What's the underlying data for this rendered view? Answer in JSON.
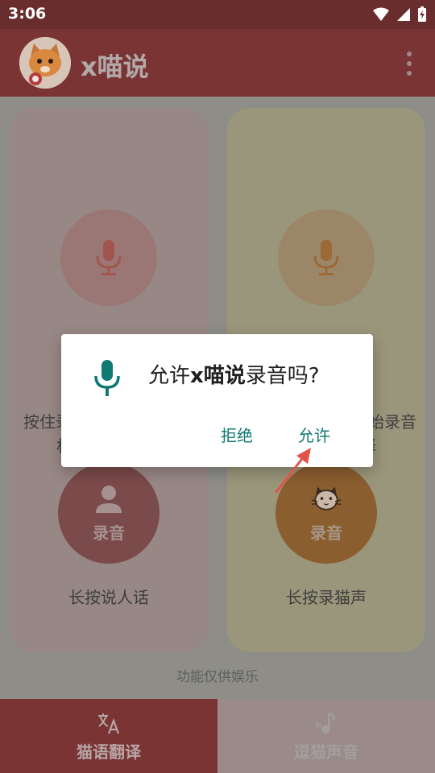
{
  "status_bar": {
    "time": "3:06"
  },
  "app_bar": {
    "title": "x喵说"
  },
  "cards": [
    {
      "hint": "按住录音",
      "hint_line2": "机",
      "record_label": "录音",
      "caption": "长按说人话"
    },
    {
      "hint": "始录音",
      "hint_line2": "译",
      "record_label": "录音",
      "caption": "长按录猫声"
    }
  ],
  "footnote": "功能仅供娱乐",
  "bottom_nav": [
    {
      "label": "猫语翻译",
      "active": true
    },
    {
      "label": "逗猫声音",
      "active": false
    }
  ],
  "dialog": {
    "title_prefix": "允许",
    "title_app": "x喵说",
    "title_suffix": "录音吗?",
    "deny_label": "拒绝",
    "allow_label": "允许"
  },
  "colors": {
    "accent": "#0f7a72",
    "primary": "#7a3434",
    "arrow": "#e2534a"
  },
  "icons": {
    "status": [
      "wifi-icon",
      "signal-icon",
      "battery-icon"
    ],
    "overflow": "more-vert-icon",
    "mic": "microphone-icon",
    "person": "person-icon",
    "cat": "cat-face-icon",
    "translate": "translate-icon",
    "music": "music-note-icon"
  }
}
